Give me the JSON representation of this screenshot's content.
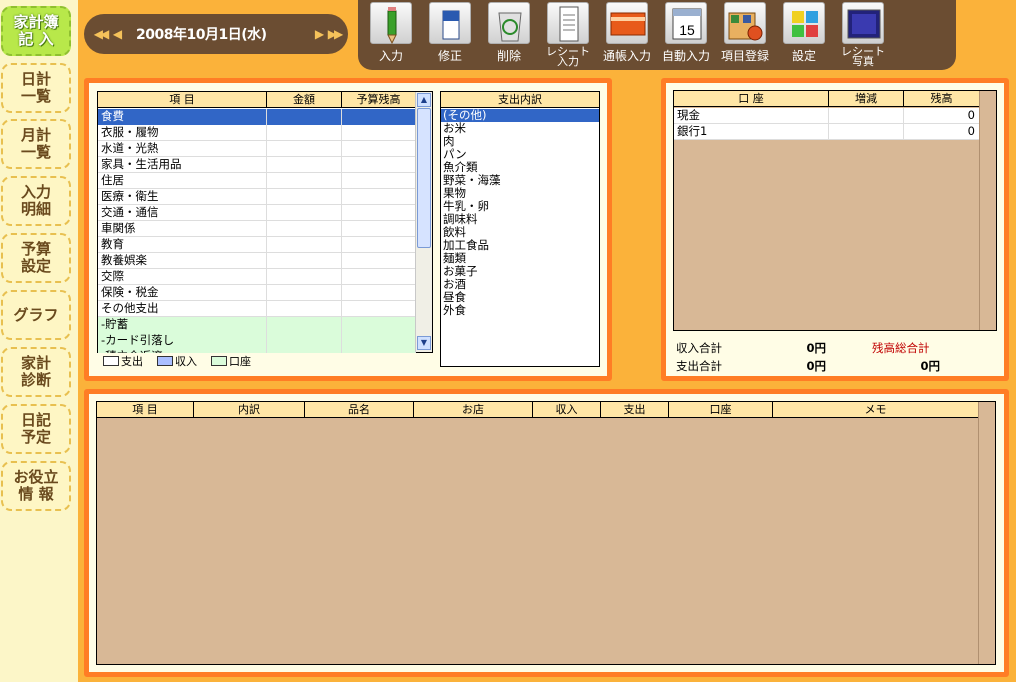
{
  "nav": {
    "items": [
      {
        "label": "家計簿\n記 入",
        "active": true
      },
      {
        "label": "日計\n一覧",
        "active": false
      },
      {
        "label": "月計\n一覧",
        "active": false
      },
      {
        "label": "入力\n明細",
        "active": false
      },
      {
        "label": "予算\n設定",
        "active": false
      },
      {
        "label": "グラフ",
        "active": false
      },
      {
        "label": "家計\n診断",
        "active": false
      },
      {
        "label": "日記\n予定",
        "active": false
      },
      {
        "label": "お役立\n情 報",
        "active": false
      }
    ]
  },
  "datebar": {
    "date": "2008年10月1日(水)",
    "first_label": "◀◀",
    "prev_label": "◀",
    "next_label": "▶",
    "last_label": "▶▶"
  },
  "toolbar": {
    "input": "入力",
    "edit": "修正",
    "delete": "削除",
    "receipt_input": "レシート\n入力",
    "passbook_input": "通帳入力",
    "auto_input": "自動入力",
    "item_register": "項目登録",
    "settings": "設定",
    "receipt_photo": "レシート\n写真"
  },
  "category_grid": {
    "headers": [
      "項 目",
      "金額",
      "予算残高"
    ],
    "rows": [
      {
        "label": "食費",
        "amount": "",
        "budget": "",
        "selected": true,
        "green": false
      },
      {
        "label": "衣服・履物",
        "amount": "",
        "budget": "",
        "selected": false,
        "green": false
      },
      {
        "label": "水道・光熱",
        "amount": "",
        "budget": "",
        "selected": false,
        "green": false
      },
      {
        "label": "家具・生活用品",
        "amount": "",
        "budget": "",
        "selected": false,
        "green": false
      },
      {
        "label": "住居",
        "amount": "",
        "budget": "",
        "selected": false,
        "green": false
      },
      {
        "label": "医療・衛生",
        "amount": "",
        "budget": "",
        "selected": false,
        "green": false
      },
      {
        "label": "交通・通信",
        "amount": "",
        "budget": "",
        "selected": false,
        "green": false
      },
      {
        "label": "車関係",
        "amount": "",
        "budget": "",
        "selected": false,
        "green": false
      },
      {
        "label": "教育",
        "amount": "",
        "budget": "",
        "selected": false,
        "green": false
      },
      {
        "label": "教養娯楽",
        "amount": "",
        "budget": "",
        "selected": false,
        "green": false
      },
      {
        "label": "交際",
        "amount": "",
        "budget": "",
        "selected": false,
        "green": false
      },
      {
        "label": "保険・税金",
        "amount": "",
        "budget": "",
        "selected": false,
        "green": false
      },
      {
        "label": "その他支出",
        "amount": "",
        "budget": "",
        "selected": false,
        "green": false
      },
      {
        "label": "-貯蓄",
        "amount": "",
        "budget": "",
        "selected": false,
        "green": true
      },
      {
        "label": "-カード引落し",
        "amount": "",
        "budget": "",
        "selected": false,
        "green": true
      },
      {
        "label": "-積立金返済",
        "amount": "",
        "budget": "",
        "selected": false,
        "green": true
      }
    ],
    "legend": {
      "expense": "支出",
      "income": "収入",
      "account": "口座"
    }
  },
  "subcategory_list": {
    "header": "支出内訳",
    "items": [
      "(その他)",
      "お米",
      "肉",
      "パン",
      "魚介類",
      "野菜・海藻",
      "果物",
      "牛乳・卵",
      "調味料",
      "飲料",
      "加工食品",
      "麺類",
      "お菓子",
      "お酒",
      "昼食",
      "外食"
    ],
    "selected_index": 0
  },
  "account_grid": {
    "headers": [
      "口 座",
      "増減",
      "残高"
    ],
    "rows": [
      {
        "name": "現金",
        "change": "",
        "balance": "0"
      },
      {
        "name": "銀行1",
        "change": "",
        "balance": "0"
      }
    ]
  },
  "totals": {
    "income_label": "収入合計",
    "income_value": "0円",
    "expense_label": "支出合計",
    "expense_value": "0円",
    "balance_label": "残高総合計",
    "balance_value": "0円"
  },
  "detail_grid": {
    "headers": [
      "項 目",
      "内訳",
      "品名",
      "お店",
      "収入",
      "支出",
      "口座",
      "メモ"
    ]
  },
  "colors": {
    "accent_orange": "#ff7d25",
    "background": "#fbb23a",
    "toolbar_brown": "#6b4d32",
    "selection_blue": "#3166c6",
    "header_yellow": "#ffe6a6",
    "balance_red": "#c00000"
  }
}
